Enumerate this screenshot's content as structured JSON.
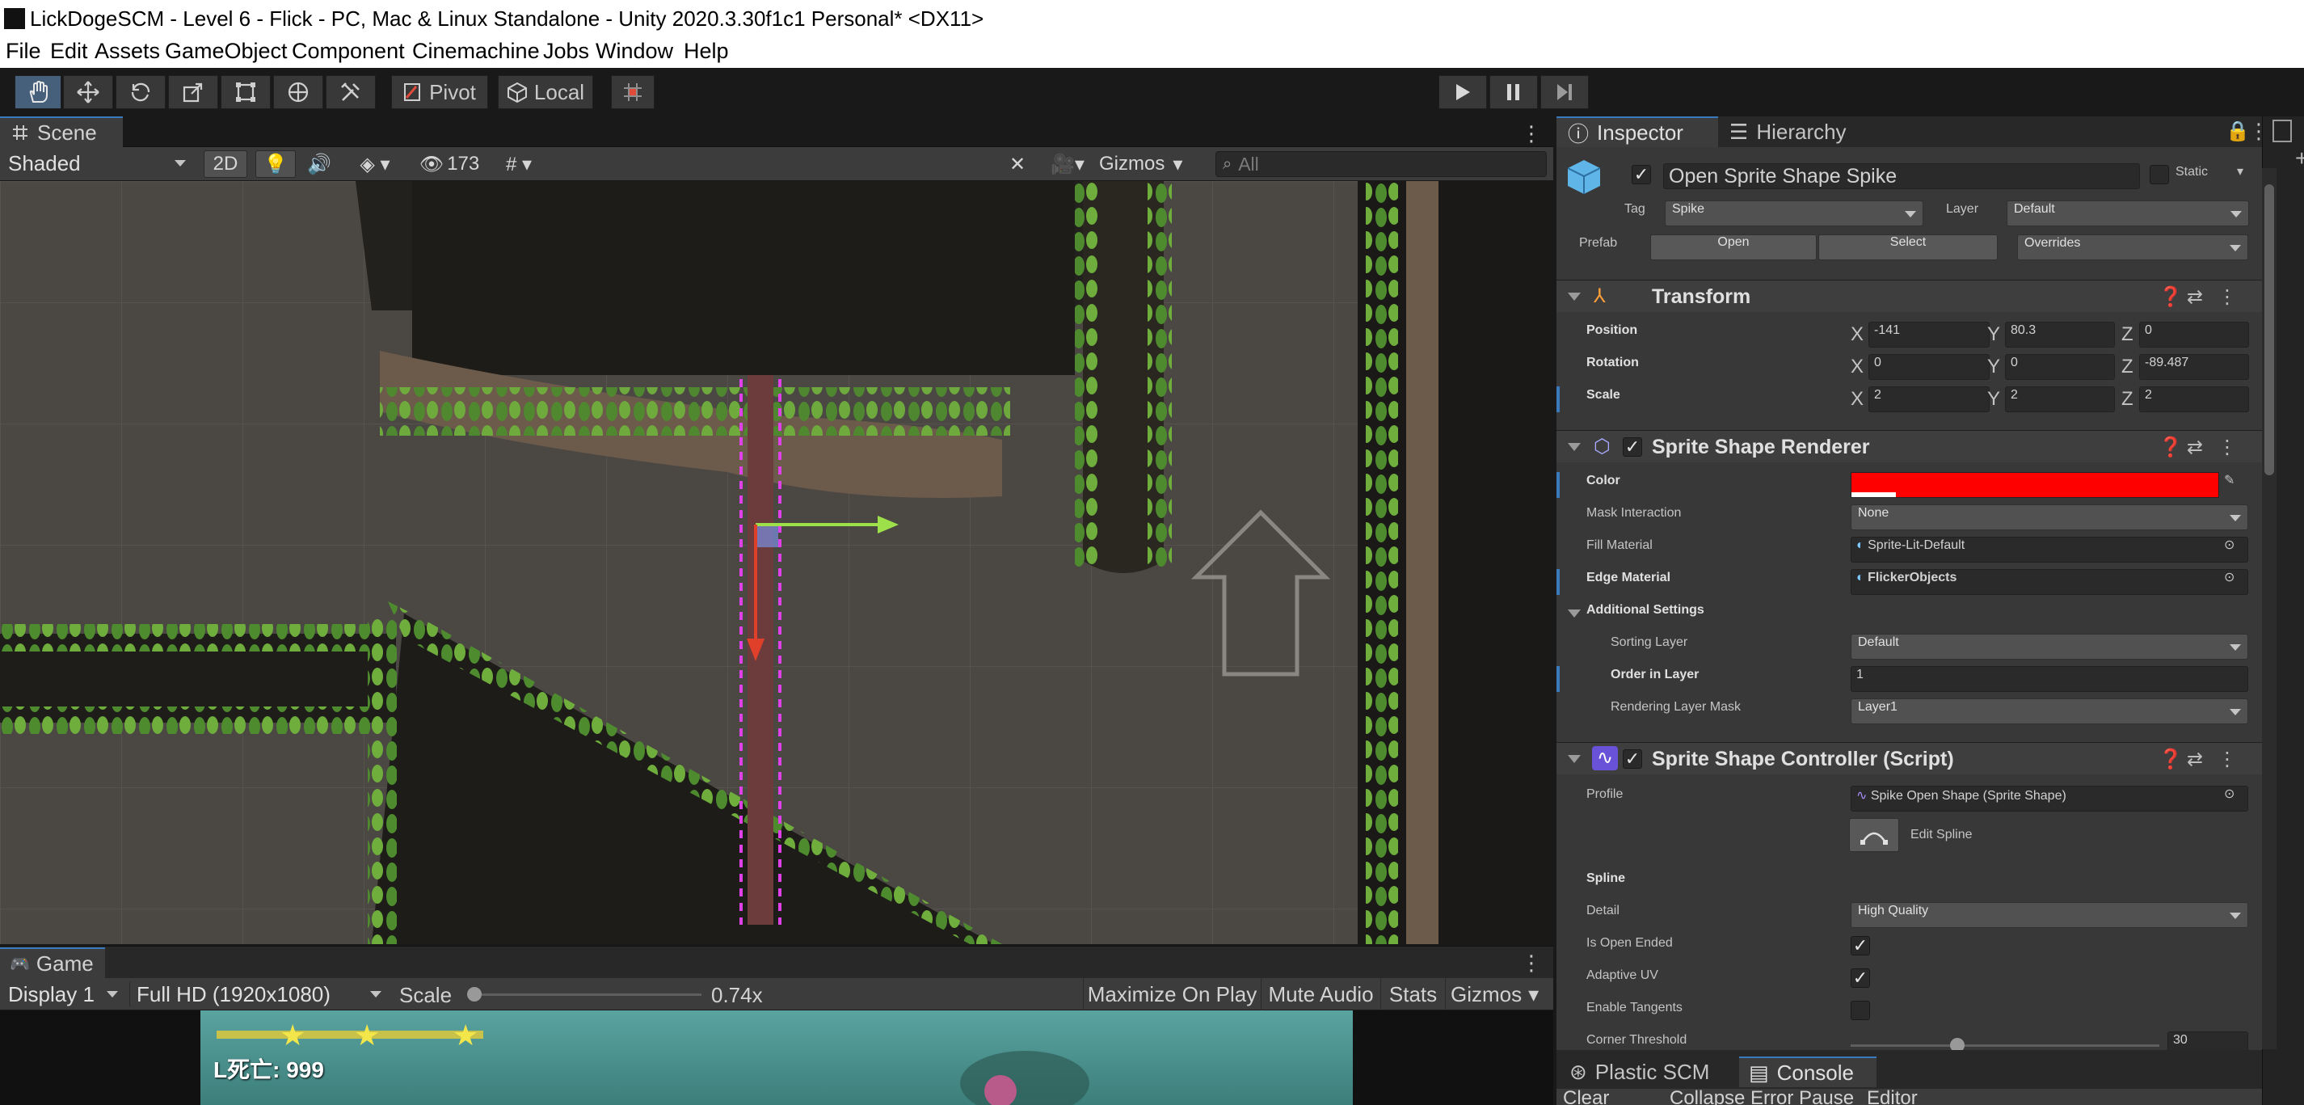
{
  "window": {
    "title": "LickDogeSCM - Level 6 - Flick - PC, Mac & Linux Standalone - Unity 2020.3.30f1c1 Personal* <DX11>"
  },
  "menu": [
    "File",
    "Edit",
    "Assets",
    "GameObject",
    "Component",
    "Cinemachine",
    "Jobs",
    "Window",
    "Help"
  ],
  "toolbar": {
    "tools": [
      "hand-tool-icon",
      "move-tool-icon",
      "rotate-tool-icon",
      "scale-tool-icon",
      "rect-tool-icon",
      "transform-tool-icon",
      "custom-tool-icon"
    ],
    "pivot_label": "Pivot",
    "local_label": "Local",
    "grid_snap": "grid-snap-icon",
    "play": "play-icon",
    "pause": "pause-icon",
    "step": "step-icon"
  },
  "scene": {
    "tab_label": "Scene",
    "draw_mode": "Shaded",
    "mode_2d": "2D",
    "hidden_count": "173",
    "gizmos_label": "Gizmos",
    "search_placeholder": "All"
  },
  "game": {
    "tab_label": "Game",
    "display": "Display 1",
    "resolution": "Full HD (1920x1080)",
    "scale_label": "Scale",
    "scale_value": "0.74x",
    "scale_slider_fraction": 0.0,
    "maximize_label": "Maximize On Play",
    "mute_label": "Mute Audio",
    "stats_label": "Stats",
    "gizmos_label": "Gizmos",
    "hud_text": "L死亡: 999"
  },
  "inspector": {
    "tab_inspector": "Inspector",
    "tab_hierarchy": "Hierarchy",
    "object_name": "Open Sprite Shape Spike",
    "static_label": "Static",
    "tag_label": "Tag",
    "tag_value": "Spike",
    "layer_label": "Layer",
    "layer_value": "Default",
    "prefab_label": "Prefab",
    "prefab_open": "Open",
    "prefab_select": "Select",
    "prefab_overrides": "Overrides",
    "transform": {
      "title": "Transform",
      "position_label": "Position",
      "pos_x": "-141",
      "pos_y": "80.3",
      "pos_z": "0",
      "rotation_label": "Rotation",
      "rot_x": "0",
      "rot_y": "0",
      "rot_z": "-89.487",
      "scale_label": "Scale",
      "scale_x": "2",
      "scale_y": "2",
      "scale_z": "2"
    },
    "renderer": {
      "title": "Sprite Shape Renderer",
      "color_label": "Color",
      "color_value": "#ff0000",
      "mask_label": "Mask Interaction",
      "mask_value": "None",
      "fill_label": "Fill Material",
      "fill_value": "Sprite-Lit-Default",
      "edge_label": "Edge Material",
      "edge_value": "FlickerObjects",
      "additional_label": "Additional Settings",
      "sorting_label": "Sorting Layer",
      "sorting_value": "Default",
      "order_label": "Order in Layer",
      "order_value": "1",
      "rendering_mask_label": "Rendering Layer Mask",
      "rendering_mask_value": "Layer1"
    },
    "controller": {
      "title": "Sprite Shape Controller (Script)",
      "profile_label": "Profile",
      "profile_value": "Spike Open Shape (Sprite Shape)",
      "edit_spline_label": "Edit Spline",
      "spline_label": "Spline",
      "detail_label": "Detail",
      "detail_value": "High Quality",
      "open_ended_label": "Is Open Ended",
      "open_ended": true,
      "adaptive_uv_label": "Adaptive UV",
      "adaptive_uv": true,
      "tangents_label": "Enable Tangents",
      "tangents": false,
      "corner_label": "Corner Threshold",
      "corner_value": "30"
    }
  },
  "bottom_tabs": {
    "plastic": "Plastic SCM",
    "console": "Console",
    "clear": "Clear",
    "collapse": "Collapse",
    "error_pause": "Error Pause",
    "editor": "Editor"
  },
  "colors": {
    "accent": "#3a79bb",
    "panel": "#383838",
    "toolbar": "#3c3c3c"
  }
}
